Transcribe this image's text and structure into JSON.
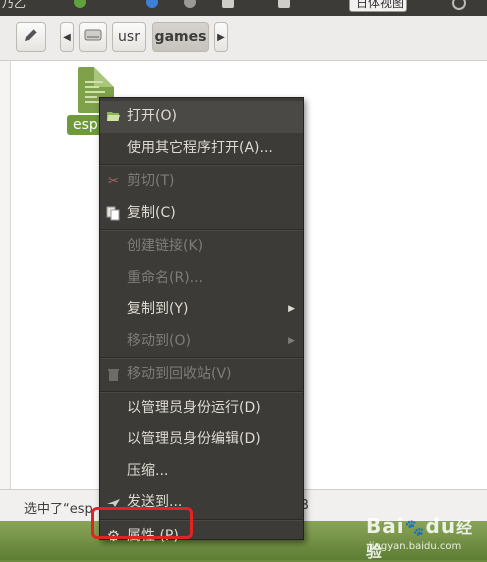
{
  "toolbar": {
    "path": [
      "usr",
      "games"
    ],
    "active_path_index": 1
  },
  "top_strip": {
    "left_fragment": "乃乙",
    "search_box_text": "日体视图"
  },
  "file": {
    "label": "esp"
  },
  "status_bar": {
    "text": "选中了“esp",
    "tail": "B"
  },
  "context_menu": {
    "items": [
      {
        "label": "打开(O)",
        "enabled": true,
        "icon": "open-folder-icon",
        "submenu": false
      },
      {
        "label": "使用其它程序打开(A)...",
        "enabled": true,
        "icon": "",
        "submenu": false
      },
      {
        "label": "剪切(T)",
        "enabled": false,
        "icon": "scissors-icon",
        "submenu": false
      },
      {
        "label": "复制(C)",
        "enabled": true,
        "icon": "copy-icon",
        "submenu": false
      },
      {
        "label": "创建链接(K)",
        "enabled": false,
        "icon": "",
        "submenu": false
      },
      {
        "label": "重命名(R)...",
        "enabled": false,
        "icon": "",
        "submenu": false
      },
      {
        "label": "复制到(Y)",
        "enabled": true,
        "icon": "",
        "submenu": true
      },
      {
        "label": "移动到(O)",
        "enabled": false,
        "icon": "",
        "submenu": true
      },
      {
        "label": "移动到回收站(V)",
        "enabled": false,
        "icon": "trash-icon",
        "submenu": false
      },
      {
        "label": "以管理员身份运行(D)",
        "enabled": true,
        "icon": "",
        "submenu": false
      },
      {
        "label": "以管理员身份编辑(D)",
        "enabled": true,
        "icon": "",
        "submenu": false
      },
      {
        "label": "压缩...",
        "enabled": true,
        "icon": "",
        "submenu": false
      },
      {
        "label": "发送到...",
        "enabled": true,
        "icon": "send-icon",
        "submenu": false
      },
      {
        "label": "属性 (P)",
        "enabled": true,
        "icon": "gear-icon",
        "submenu": false
      }
    ]
  },
  "watermark": {
    "brand": "Bai",
    "brand_mid": "du",
    "brand_tail": "经验",
    "sub": "jingyan.baidu.com"
  },
  "colors": {
    "menu_bg": "#3c3b37",
    "menu_text": "#dfdbd2",
    "menu_disabled": "#7f7d78",
    "highlight": "#e02424",
    "file_label_bg": "#6e9a3a"
  }
}
